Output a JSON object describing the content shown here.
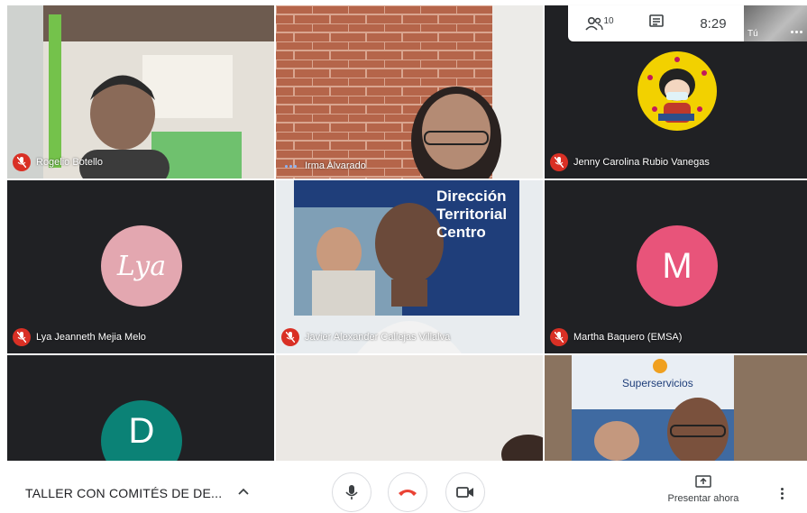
{
  "participants_count": "10",
  "clock": "8:29",
  "self_label": "Tú",
  "tiles": {
    "rogelio": {
      "name": "Rogelio Botello"
    },
    "irma": {
      "name": "Irma Alvarado"
    },
    "jenny": {
      "name": "Jenny Carolina Rubio Vanegas"
    },
    "lya": {
      "name": "Lya Jeanneth Mejia Melo",
      "avatar_text": "Lya"
    },
    "javier": {
      "name": "Javier Alexander Callejas Villalva",
      "banner_text": "Dirección\nTerritorial\nCentro"
    },
    "martha": {
      "name": "Martha Baquero (EMSA)",
      "avatar_letter": "M"
    },
    "d": {
      "avatar_letter": "D"
    },
    "last": {
      "banner_text": "Superservicios"
    }
  },
  "bottom_bar": {
    "meeting_title": "TALLER CON COMITÉS DE DE...",
    "present_label": "Presentar ahora"
  },
  "colors": {
    "tile_bg": "#202124",
    "mute_red": "#d93025",
    "hangup_red": "#ea4335",
    "avatar_pink": "#e8547a",
    "avatar_teal": "#0b8276",
    "lya_pink": "#e3a7b0"
  },
  "icons": {
    "participants": "people-icon",
    "chat": "chat-icon",
    "mic": "microphone-icon",
    "hangup": "phone-hangup-icon",
    "camera": "camera-icon",
    "present": "present-screen-icon",
    "more": "more-vertical-icon"
  }
}
